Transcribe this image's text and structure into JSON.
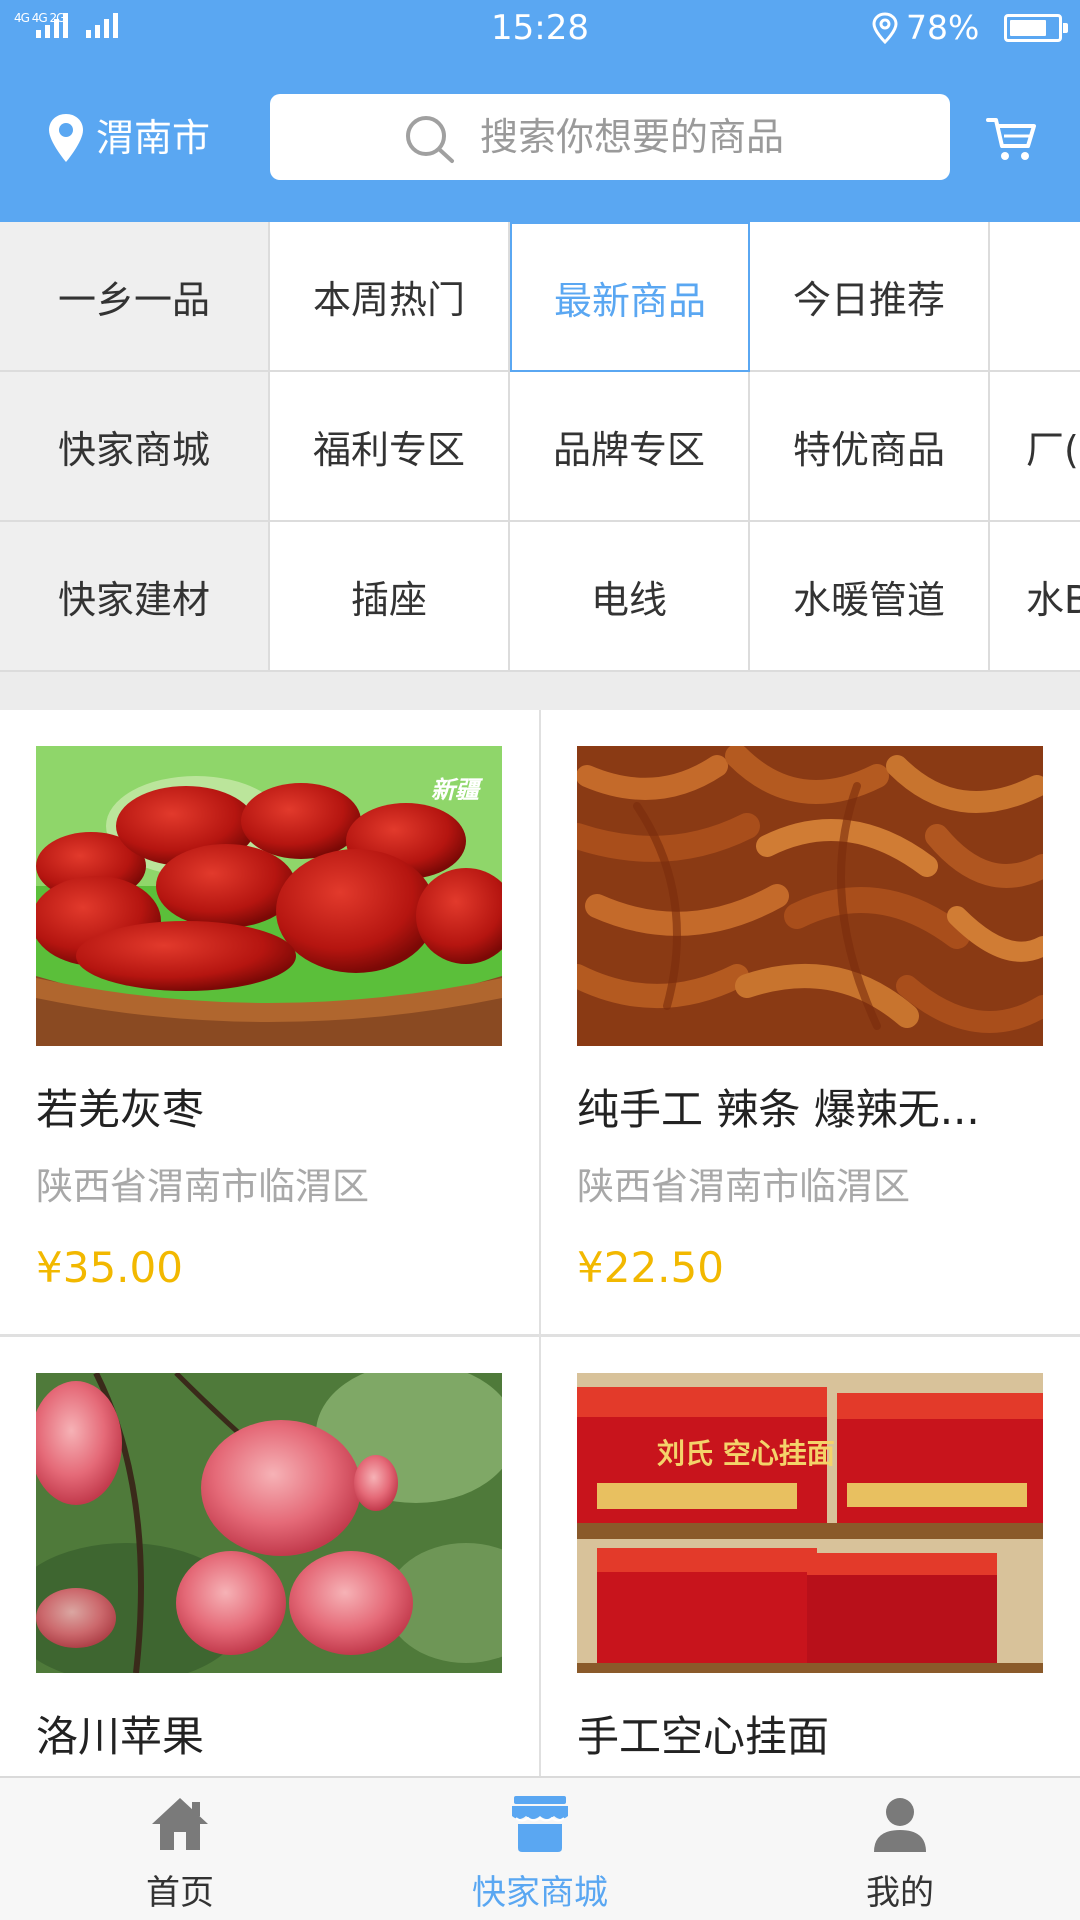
{
  "status_bar": {
    "network": "4G 4G 2G",
    "time": "15:28",
    "battery_percent": "78%",
    "battery_level": 0.78
  },
  "header": {
    "city": "渭南市",
    "search_placeholder": "搜索你想要的商品"
  },
  "categories": [
    [
      "一乡一品",
      "本周热门",
      "最新商品",
      "今日推荐",
      ""
    ],
    [
      "快家商城",
      "福利专区",
      "品牌专区",
      "特优商品",
      "厂("
    ],
    [
      "快家建材",
      "插座",
      "电线",
      "水暖管道",
      "水B"
    ]
  ],
  "active_category": "最新商品",
  "products": [
    {
      "name": "若羌灰枣",
      "address": "陕西省渭南市临渭区",
      "price": "¥35.00",
      "image": "red-dates-photo",
      "image_text": "新疆"
    },
    {
      "name": "纯手工 辣条 爆辣无...",
      "address": "陕西省渭南市临渭区",
      "price": "¥22.50",
      "image": "spicy-strips-photo"
    },
    {
      "name": "洛川苹果",
      "image": "apples-photo"
    },
    {
      "name": "手工空心挂面",
      "image": "noodle-boxes-photo",
      "image_text": "刘氏 空心挂面"
    }
  ],
  "tabs": [
    {
      "label": "首页",
      "icon": "home-icon"
    },
    {
      "label": "快家商城",
      "icon": "store-icon",
      "active": true
    },
    {
      "label": "我的",
      "icon": "user-icon"
    }
  ],
  "colors": {
    "brand_blue": "#5aa7f2",
    "price_yellow": "#f2b800",
    "grid_border": "#dcdcdc",
    "first_column_bg": "#efefef"
  }
}
